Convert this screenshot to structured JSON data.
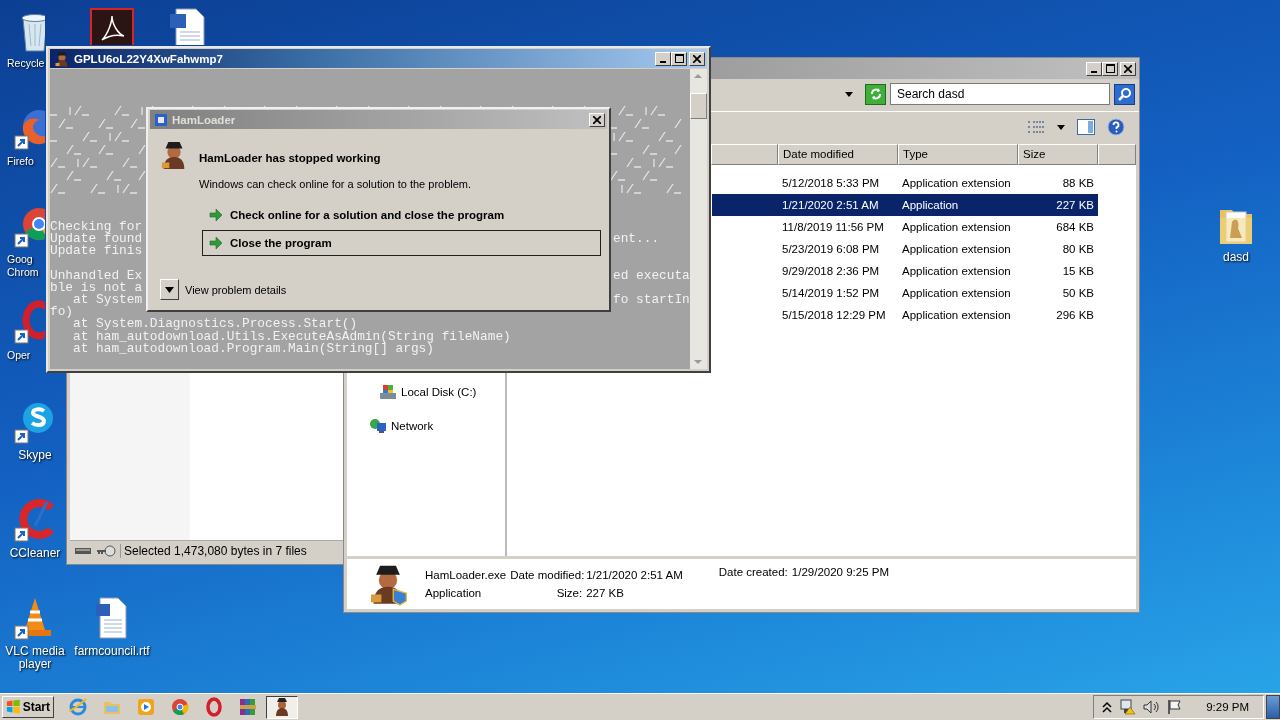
{
  "desktop_icons": [
    {
      "lines": [
        "Recycle"
      ]
    },
    {
      "lines": [
        "Firefo"
      ]
    },
    {
      "lines": [
        "Goog",
        "Chrom"
      ]
    },
    {
      "lines": [
        "Oper"
      ]
    },
    {
      "lines": [
        "Skype"
      ]
    },
    {
      "lines": [
        "CCleaner"
      ]
    },
    {
      "lines": [
        "VLC media",
        "player"
      ]
    },
    {
      "lines": [
        "farmcouncil.rtf"
      ]
    },
    {
      "lines": [
        "dasd"
      ]
    }
  ],
  "back_window": {
    "status": "Selected 1,473,080 bytes in 7 files"
  },
  "explorer": {
    "search": {
      "placeholder": "Search dasd"
    },
    "columns": [
      "Date modified",
      "Type",
      "Size"
    ],
    "rows": [
      {
        "date": "5/12/2018 5:33 PM",
        "type": "Application extension",
        "size": "88 KB",
        "selected": false
      },
      {
        "date": "1/21/2020 2:51 AM",
        "type": "Application",
        "size": "227 KB",
        "selected": true
      },
      {
        "date": "11/8/2019 11:56 PM",
        "type": "Application extension",
        "size": "684 KB",
        "selected": false
      },
      {
        "date": "5/23/2019 6:08 PM",
        "type": "Application extension",
        "size": "80 KB",
        "selected": false
      },
      {
        "date": "9/29/2018 2:36 PM",
        "type": "Application extension",
        "size": "15 KB",
        "selected": false
      },
      {
        "date": "5/14/2019 1:52 PM",
        "type": "Application extension",
        "size": "50 KB",
        "selected": false
      },
      {
        "date": "5/15/2018 12:29 PM",
        "type": "Application extension",
        "size": "296 KB",
        "selected": false
      }
    ],
    "nav": [
      "Local Disk (C:)",
      "Network"
    ],
    "details": {
      "name": "HamLoader.exe",
      "type": "Application",
      "fields": [
        {
          "label": "Date modified:",
          "value": "1/21/2020 2:51 AM"
        },
        {
          "label": "Size:",
          "value": "227 KB"
        },
        {
          "label": "Date created:",
          "value": "1/29/2020 9:25 PM"
        }
      ]
    }
  },
  "console": {
    "title": "GPLU6oL22Y4XwFahwmp7",
    "blocks": [
      [
        {
          "left": "Checking for"
        },
        {
          "left": "Update found",
          "right": "ent..."
        },
        {
          "left": "Update finis"
        }
      ],
      [
        {
          "left": "Unhandled Ex",
          "right": "ed executa"
        },
        {
          "left": "ble is not a"
        },
        {
          "left": "   at System",
          "right": "fo startIn"
        },
        {
          "left": "fo)"
        },
        {
          "left": "   at System.Diagnostics.Process.Start()"
        },
        {
          "left": "   at ham_autodownload.Utils.ExecuteAsAdmin(String fileName)"
        },
        {
          "left": "   at ham_autodownload.Program.Main(String[] args)"
        }
      ]
    ]
  },
  "dialog": {
    "title": "HamLoader",
    "heading": "HamLoader has stopped working",
    "text": "Windows can check online for a solution to the problem.",
    "options": [
      {
        "label": "Check online for a solution and close the program",
        "selected": false
      },
      {
        "label": "Close the program",
        "selected": true
      }
    ],
    "details_toggle": "View problem details"
  },
  "taskbar": {
    "start": "Start",
    "apps": [
      {
        "active": false
      },
      {
        "active": false
      },
      {
        "active": false
      },
      {
        "active": false
      },
      {
        "active": false
      },
      {
        "active": false
      },
      {
        "active": true
      }
    ],
    "clock": "9:29 PM"
  }
}
